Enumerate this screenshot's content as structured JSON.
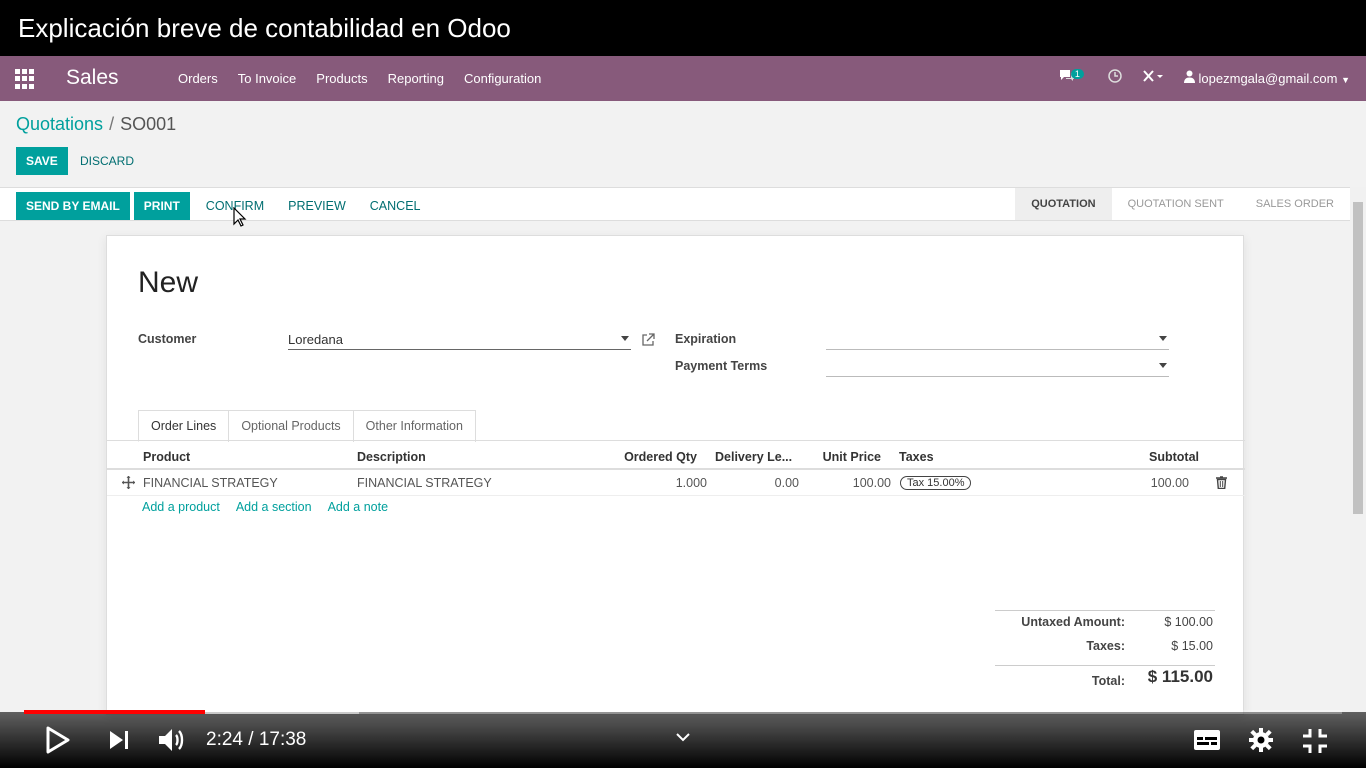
{
  "video": {
    "title": "Explicación breve de contabilidad en Odoo",
    "time": "2:24 / 17:38",
    "played_fraction": 0.137,
    "loaded_fraction": 0.254
  },
  "navbar": {
    "app_name": "Sales",
    "menu": [
      "Orders",
      "To Invoice",
      "Products",
      "Reporting",
      "Configuration"
    ],
    "messages_count": "1",
    "user": "lopezmgala@gmail.com"
  },
  "breadcrumb": {
    "parent": "Quotations",
    "current": "SO001"
  },
  "buttons": {
    "save": "SAVE",
    "discard": "DISCARD"
  },
  "actions": {
    "send_by_email": "SEND BY EMAIL",
    "print": "PRINT",
    "confirm": "CONFIRM",
    "preview": "PREVIEW",
    "cancel": "CANCEL"
  },
  "status_steps": [
    "QUOTATION",
    "QUOTATION SENT",
    "SALES ORDER"
  ],
  "form": {
    "record_name": "New",
    "customer_label": "Customer",
    "customer_value": "Loredana",
    "expiration_label": "Expiration",
    "expiration_value": "",
    "payment_terms_label": "Payment Terms",
    "payment_terms_value": ""
  },
  "tabs": [
    "Order Lines",
    "Optional Products",
    "Other Information"
  ],
  "order_lines": {
    "headers": [
      "Product",
      "Description",
      "Ordered Qty",
      "Delivery Le...",
      "Unit Price",
      "Taxes",
      "Subtotal"
    ],
    "rows": [
      {
        "product": "FINANCIAL STRATEGY",
        "description": "FINANCIAL STRATEGY",
        "qty": "1.000",
        "delivery": "0.00",
        "unit_price": "100.00",
        "taxes": "Tax 15.00%",
        "subtotal": "100.00"
      }
    ],
    "add_links": [
      "Add a product",
      "Add a section",
      "Add a note"
    ]
  },
  "totals": {
    "untaxed_label": "Untaxed Amount:",
    "untaxed_value": "$ 100.00",
    "taxes_label": "Taxes:",
    "taxes_value": "$ 15.00",
    "total_label": "Total:",
    "total_value": "$ 115.00"
  },
  "colors": {
    "navbar": "#875a7b",
    "accent": "#00a09d",
    "progress": "#ff0000"
  }
}
